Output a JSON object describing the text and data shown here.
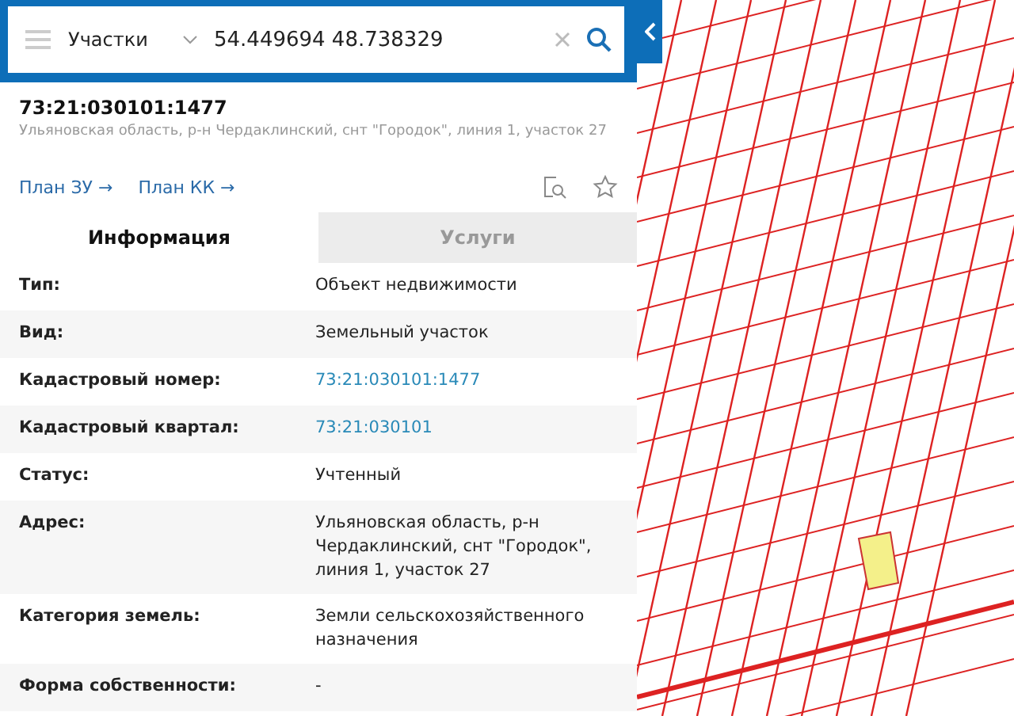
{
  "search": {
    "layer": "Участки",
    "value": "54.449694 48.738329"
  },
  "object": {
    "number": "73:21:030101:1477",
    "address": "Ульяновская область, р-н Чердаклинский, снт \"Городок\", линия 1, участок 27",
    "links": [
      {
        "label": "План ЗУ →"
      },
      {
        "label": "План КК →"
      }
    ]
  },
  "tabs": [
    {
      "label": "Информация",
      "selected": true
    },
    {
      "label": "Услуги",
      "selected": false
    }
  ],
  "rows": [
    {
      "label": "Тип:",
      "value": "Объект недвижимости",
      "kind": "text"
    },
    {
      "label": "Вид:",
      "value": "Земельный участок",
      "kind": "text"
    },
    {
      "label": "Кадастровый номер:",
      "value": "73:21:030101:1477",
      "kind": "link"
    },
    {
      "label": "Кадастровый квартал:",
      "value": "73:21:030101",
      "kind": "link"
    },
    {
      "label": "Статус:",
      "value": "Учтенный",
      "kind": "text"
    },
    {
      "label": "Адрес:",
      "value": "Ульяновская область, р-н Чердаклинский, снт \"Городок\", линия 1, участок 27",
      "kind": "text"
    },
    {
      "label": "Категория земель:",
      "value": "Земли сельскохозяйственного назначения",
      "kind": "text"
    },
    {
      "label": "Форма собственности:",
      "value": "-",
      "kind": "text"
    }
  ]
}
